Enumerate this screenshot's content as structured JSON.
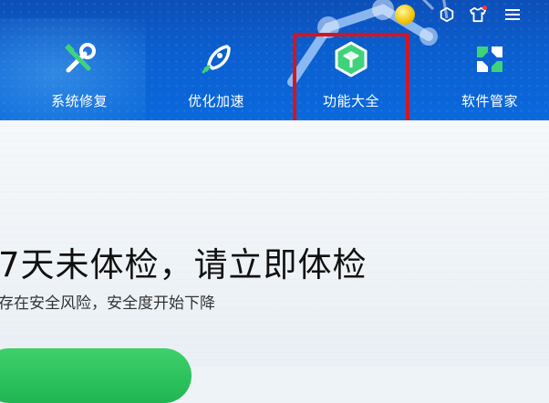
{
  "nav": {
    "items": [
      {
        "label": "系统修复",
        "icon": "wrench-screwdriver-icon"
      },
      {
        "label": "优化加速",
        "icon": "rocket-icon"
      },
      {
        "label": "功能大全",
        "icon": "cube-icon"
      },
      {
        "label": "软件管家",
        "icon": "app-grid-icon"
      }
    ],
    "highlighted_index": 2
  },
  "window_controls": {
    "icons": [
      "coin-icon",
      "hexagon-ring-icon",
      "skin-shirt-icon",
      "menu-icon"
    ]
  },
  "status": {
    "headline": "7天未体检，请立即体检",
    "subline": "存在安全风险，安全度开始下降"
  },
  "colors": {
    "header": "#0b5fd0",
    "accent_green": "#2ec866",
    "highlight_border": "#d6141f",
    "headline_text": "#111111"
  }
}
